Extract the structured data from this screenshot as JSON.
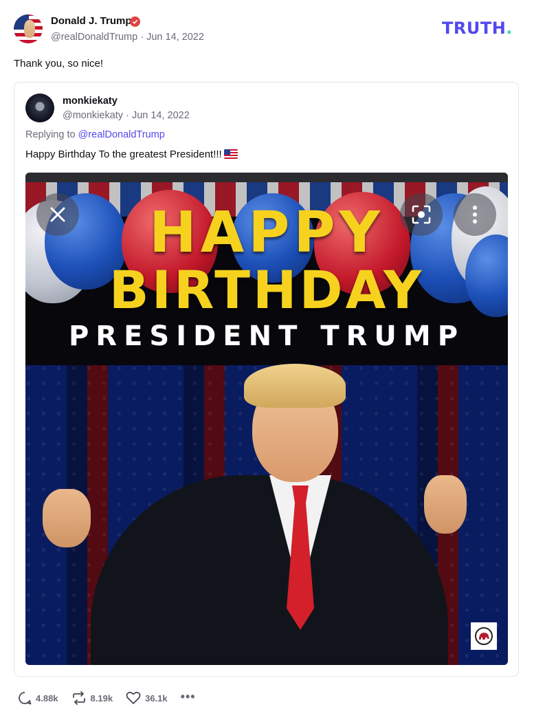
{
  "post": {
    "author_name": "Donald J. Trump",
    "meta": "@realDonaldTrump · Jun 14, 2022",
    "text": "Thank you, so nice!"
  },
  "brand": {
    "logo_text": "TRUTH",
    "logo_dot": ".",
    "colors": {
      "primary": "#5448ee",
      "accent": "#3fd6b4",
      "verified": "#e04343"
    }
  },
  "quoted": {
    "author_name": "monkiekaty",
    "meta": "@monkiekaty · Jun 14, 2022",
    "replying_prefix": "Replying to",
    "replying_to": "@realDonaldTrump",
    "text": "Happy Birthday To the greatest President!!!",
    "image": {
      "line1": "HAPPY",
      "line2": "BIRTHDAY",
      "line3": "PRESIDENT TRUMP"
    }
  },
  "actions": {
    "replies": "4.88k",
    "retruths": "8.19k",
    "likes": "36.1k",
    "more": "•••"
  },
  "icons": [
    "verified-icon",
    "close-icon",
    "lens-icon",
    "more-vertical-icon",
    "reply-icon",
    "retruth-icon",
    "heart-icon",
    "more-icon",
    "flag-icon"
  ]
}
